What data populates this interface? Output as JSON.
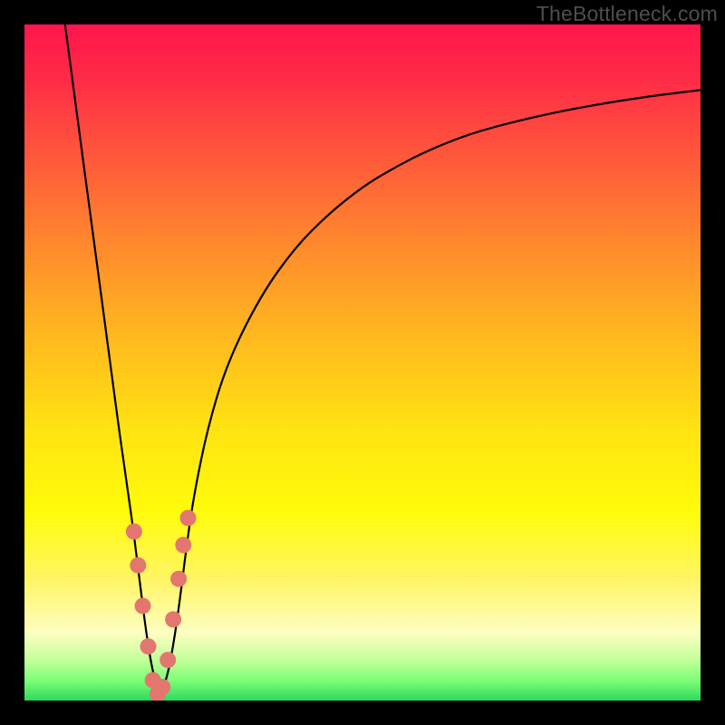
{
  "watermark": "TheBottleneck.com",
  "chart_data": {
    "type": "line",
    "title": "",
    "xlabel": "",
    "ylabel": "",
    "xlim": [
      0,
      100
    ],
    "ylim": [
      0,
      100
    ],
    "grid": false,
    "series": [
      {
        "name": "bottleneck-curve",
        "x": [
          6,
          8,
          10,
          12,
          14,
          15,
          16,
          17,
          18,
          19,
          20,
          21,
          22,
          23,
          24,
          25,
          27,
          30,
          35,
          40,
          45,
          50,
          55,
          60,
          65,
          70,
          75,
          80,
          85,
          90,
          95,
          100
        ],
        "values": [
          100,
          85,
          70,
          55,
          40,
          33,
          26,
          18,
          10,
          4,
          1,
          3,
          8,
          15,
          23,
          30,
          40,
          50,
          60,
          67,
          72,
          76,
          79,
          81.5,
          83.5,
          85,
          86.2,
          87.3,
          88.2,
          89,
          89.7,
          90.3
        ]
      }
    ],
    "markers": {
      "name": "highlight-points",
      "color": "#e3766f",
      "x": [
        16.2,
        16.8,
        17.5,
        18.3,
        19.0,
        19.7,
        20.4,
        21.2,
        22.0,
        22.8,
        23.5,
        24.2
      ],
      "values": [
        25,
        20,
        14,
        8,
        3,
        1,
        2,
        6,
        12,
        18,
        23,
        27
      ]
    },
    "gradient_stops": [
      {
        "pos": 0,
        "color": "#ff154c"
      },
      {
        "pos": 0.6,
        "color": "#ffe312"
      },
      {
        "pos": 0.9,
        "color": "#fdfec1"
      },
      {
        "pos": 1.0,
        "color": "#2dd95d"
      }
    ]
  }
}
